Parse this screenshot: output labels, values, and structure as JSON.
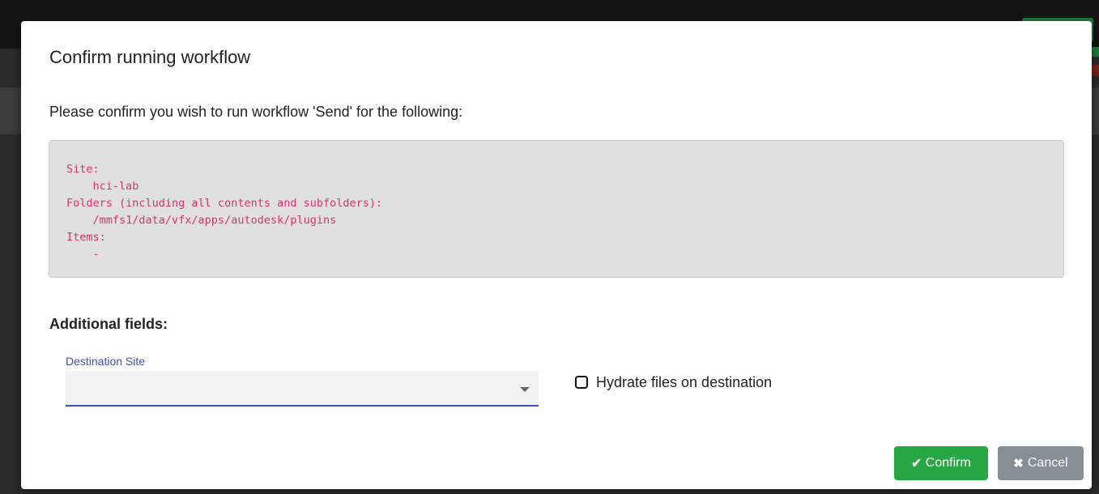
{
  "modal": {
    "title": "Confirm running workflow",
    "confirm_text": "Please confirm you wish to run workflow 'Send' for the following:",
    "details": "Site:\n    hci-lab\nFolders (including all contents and subfolders):\n    /mmfs1/data/vfx/apps/autodesk/plugins\nItems:\n    -",
    "additional_fields_title": "Additional fields:",
    "destination_site": {
      "label": "Destination Site",
      "value": ""
    },
    "hydrate": {
      "label": "Hydrate files on destination",
      "checked": false
    },
    "buttons": {
      "confirm_label": "Confirm",
      "confirm_icon": "check-icon",
      "cancel_label": "Cancel",
      "cancel_icon": "close-icon"
    }
  },
  "colors": {
    "confirm": "#28a745",
    "cancel": "#868e96",
    "code_text": "#d6336c",
    "field_accent": "#3f51b5"
  }
}
